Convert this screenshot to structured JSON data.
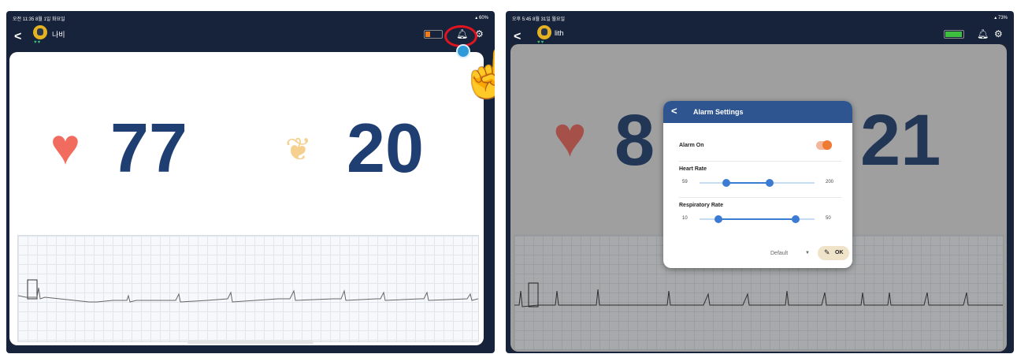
{
  "left": {
    "status": {
      "time": "오전 11:35 8월 1일 화요일",
      "battery": "60%"
    },
    "topbar": {
      "back_icon": "chevron-left",
      "hearts": "♥♥",
      "user_name": "나비",
      "battery_color": "#f07d1c",
      "battery_level": 0.3
    },
    "vitals": {
      "heart_rate": "77",
      "respiratory_rate": "20"
    }
  },
  "right": {
    "status": {
      "time": "오후 5:45 8월 31일 월요일",
      "battery": "73%"
    },
    "topbar": {
      "back_icon": "chevron-left",
      "hearts": "♥♥",
      "user_name": "lith",
      "battery_color": "#3fbf3f",
      "battery_level": 1.0
    },
    "vitals": {
      "heart_rate_partial": "8",
      "respiratory_rate_partial": "21"
    },
    "modal": {
      "title": "Alarm Settings",
      "alarm_on": {
        "label": "Alarm On",
        "on": true
      },
      "heart_rate": {
        "label": "Heart Rate",
        "min_label": "59",
        "max_label": "200",
        "range_min": 0,
        "range_max": 250,
        "low": 59,
        "high": 152
      },
      "respiratory_rate": {
        "label": "Respiratory Rate",
        "min_label": "10",
        "max_label": "50",
        "range_min": 0,
        "range_max": 60,
        "low": 10,
        "high": 50
      },
      "preset": "Default",
      "ok_label": "OK"
    }
  },
  "colors": {
    "heart": "#f26b5f",
    "vital_number": "#1f3f73",
    "modal_header": "#2f5591",
    "toggle_on": "#ee7a33",
    "slider": "#3b7bd4",
    "tap_highlight": "#e0151f"
  }
}
